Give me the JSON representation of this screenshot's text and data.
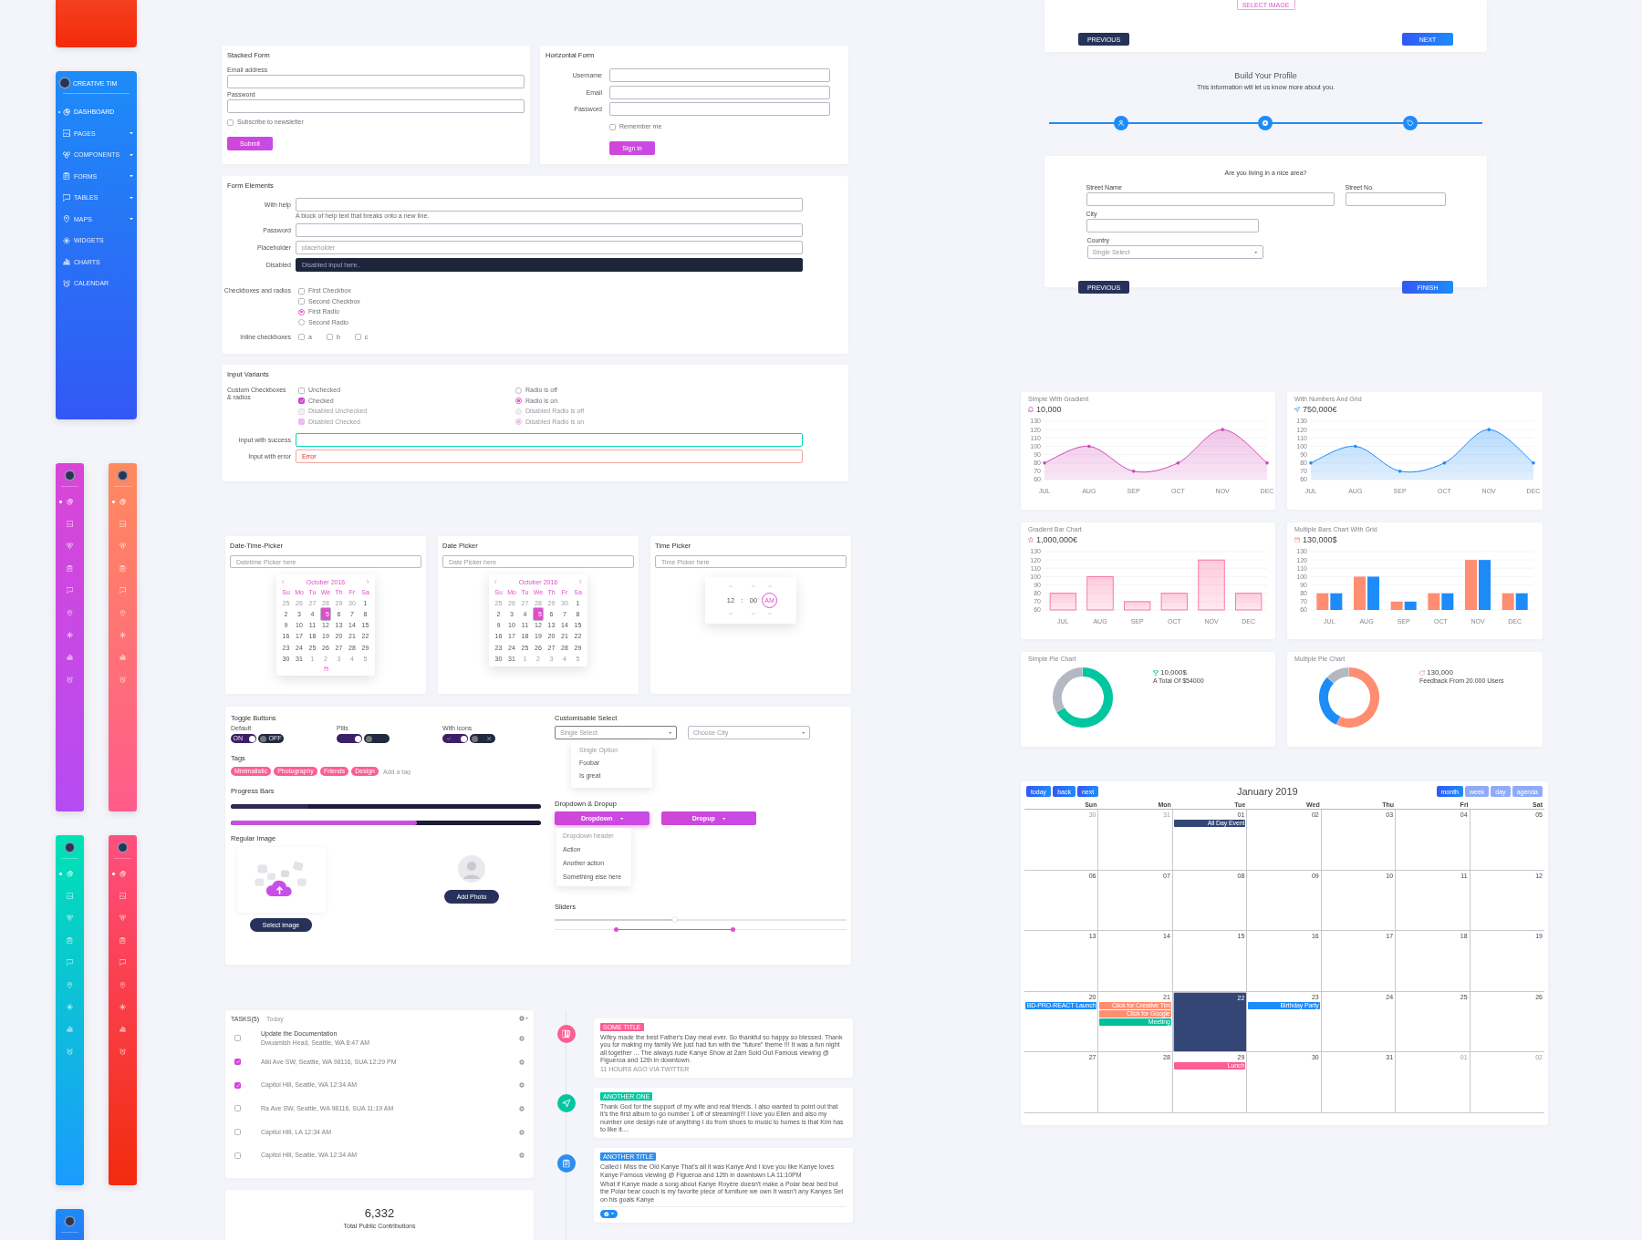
{
  "sidebar": {
    "brand": "CREATIVE TIM",
    "items": [
      {
        "label": "DASHBOARD",
        "selected": true,
        "submenu": false
      },
      {
        "label": "PAGES",
        "selected": false,
        "submenu": true
      },
      {
        "label": "COMPONENTS",
        "selected": false,
        "submenu": true
      },
      {
        "label": "FORMS",
        "selected": false,
        "submenu": true
      },
      {
        "label": "TABLES",
        "selected": false,
        "submenu": true
      },
      {
        "label": "MAPS",
        "selected": false,
        "submenu": true
      },
      {
        "label": "WIDGETS",
        "selected": false,
        "submenu": false
      },
      {
        "label": "CHARTS",
        "selected": false,
        "submenu": false
      },
      {
        "label": "CALENDAR",
        "selected": false,
        "submenu": false
      }
    ]
  },
  "mini_sidebars": [
    {
      "color": "#d946d6",
      "items": [
        {
          "selected": true
        },
        {
          "selected": false
        },
        {
          "selected": false
        },
        {
          "selected": false
        },
        {
          "selected": false
        },
        {
          "selected": false
        },
        {
          "selected": false
        },
        {
          "selected": false
        },
        {
          "selected": false
        }
      ]
    },
    {
      "color": "#ff8a5e",
      "items": [
        {
          "selected": true
        },
        {
          "selected": false
        },
        {
          "selected": false
        },
        {
          "selected": false
        },
        {
          "selected": false
        },
        {
          "selected": false
        },
        {
          "selected": false
        },
        {
          "selected": false
        },
        {
          "selected": false
        }
      ]
    },
    {
      "color": "#00e2b4",
      "items": [
        {
          "selected": true
        },
        {
          "selected": false
        },
        {
          "selected": false
        },
        {
          "selected": false
        },
        {
          "selected": false
        },
        {
          "selected": false
        },
        {
          "selected": false
        },
        {
          "selected": false
        },
        {
          "selected": false
        }
      ]
    },
    {
      "color": "#ff4f7f",
      "items": [
        {
          "selected": true
        },
        {
          "selected": false
        },
        {
          "selected": false
        },
        {
          "selected": false
        },
        {
          "selected": false
        },
        {
          "selected": false
        },
        {
          "selected": false
        },
        {
          "selected": false
        },
        {
          "selected": false
        }
      ]
    },
    {
      "color": "#1d8cf8"
    }
  ],
  "stacked_form": {
    "title": "Stacked Form",
    "fields": [
      {
        "label": "Email address"
      },
      {
        "label": "Password"
      }
    ],
    "checkbox": {
      "label": "Subscribe to newsletter",
      "checked": false
    },
    "button": "Submit"
  },
  "horizontal_form": {
    "title": "Horizontal Form",
    "fields": [
      {
        "label": "Username"
      },
      {
        "label": "Email"
      },
      {
        "label": "Password"
      }
    ],
    "checkbox": {
      "label": "Remember me",
      "checked": false
    },
    "button": "Sign in"
  },
  "form_elements": {
    "title": "Form Elements",
    "fields": [
      {
        "label": "With help",
        "disabled": false,
        "help": "A block of help text that breaks onto a new line."
      },
      {
        "label": "Password",
        "disabled": false
      },
      {
        "label": "Placeholder",
        "disabled": false,
        "placeholder": "placeholder"
      },
      {
        "label": "Disabled",
        "disabled": true,
        "placeholder": "Disabled input here.."
      }
    ],
    "choices": {
      "label": "Checkboxes and radios",
      "items": [
        {
          "kind": "checkbox",
          "label": "First Checkbox",
          "checked": false
        },
        {
          "kind": "checkbox",
          "label": "Second Checkbox",
          "checked": false
        },
        {
          "kind": "radio",
          "label": "First Radio",
          "selected": true
        },
        {
          "kind": "radio",
          "label": "Second Radio",
          "selected": false
        }
      ]
    },
    "inline": {
      "label": "Inline checkboxes",
      "items": [
        {
          "label": "a",
          "checked": false
        },
        {
          "label": "b",
          "checked": false
        },
        {
          "label": "c",
          "checked": false
        }
      ]
    }
  },
  "input_variants": {
    "title": "Input Variants",
    "group_label": "Custom Checkboxes & radios",
    "checkboxes": [
      {
        "label": "Unchecked",
        "checked": false,
        "disabled": false
      },
      {
        "label": "Checked",
        "checked": true,
        "disabled": false
      },
      {
        "label": "Disabled Unchecked",
        "checked": false,
        "disabled": true
      },
      {
        "label": "Disabled Checked",
        "checked": true,
        "disabled": true
      }
    ],
    "radios": [
      {
        "label": "Radio is off",
        "selected": false,
        "disabled": false
      },
      {
        "label": "Radio is on",
        "selected": true,
        "disabled": false
      },
      {
        "label": "Disabled Radio is off",
        "selected": false,
        "disabled": true
      },
      {
        "label": "Disabled Radio is on",
        "selected": true,
        "disabled": true
      }
    ],
    "fields": [
      {
        "label": "Input with success",
        "kind": "success"
      },
      {
        "label": "Input with error",
        "kind": "error",
        "value": "Error"
      }
    ]
  },
  "pickers": [
    {
      "kind": "datetime",
      "title": "Date-Time-Picker",
      "placeholder": "Datetime Picker here",
      "calendar": {
        "month": "October 2016",
        "weekdays": [
          "Su",
          "Mo",
          "Tu",
          "We",
          "Th",
          "Fr",
          "Sa"
        ],
        "days": [
          {
            "day": "25",
            "outside": true,
            "selected": false
          },
          {
            "day": "26",
            "outside": true,
            "selected": false
          },
          {
            "day": "27",
            "outside": true,
            "selected": false
          },
          {
            "day": "28",
            "outside": true,
            "selected": false
          },
          {
            "day": "29",
            "outside": true,
            "selected": false
          },
          {
            "day": "30",
            "outside": true,
            "selected": false
          },
          {
            "day": "1",
            "outside": false,
            "selected": false
          },
          {
            "day": "2",
            "outside": false,
            "selected": false
          },
          {
            "day": "3",
            "outside": false,
            "selected": false
          },
          {
            "day": "4",
            "outside": false,
            "selected": false
          },
          {
            "day": "5",
            "outside": false,
            "selected": true
          },
          {
            "day": "6",
            "outside": false,
            "selected": false
          },
          {
            "day": "7",
            "outside": false,
            "selected": false
          },
          {
            "day": "8",
            "outside": false,
            "selected": false
          },
          {
            "day": "9",
            "outside": false,
            "selected": false
          },
          {
            "day": "10",
            "outside": false,
            "selected": false
          },
          {
            "day": "11",
            "outside": false,
            "selected": false
          },
          {
            "day": "12",
            "outside": false,
            "selected": false
          },
          {
            "day": "13",
            "outside": false,
            "selected": false
          },
          {
            "day": "14",
            "outside": false,
            "selected": false
          },
          {
            "day": "15",
            "outside": false,
            "selected": false
          },
          {
            "day": "16",
            "outside": false,
            "selected": false
          },
          {
            "day": "17",
            "outside": false,
            "selected": false
          },
          {
            "day": "18",
            "outside": false,
            "selected": false
          },
          {
            "day": "19",
            "outside": false,
            "selected": false
          },
          {
            "day": "20",
            "outside": false,
            "selected": false
          },
          {
            "day": "21",
            "outside": false,
            "selected": false
          },
          {
            "day": "22",
            "outside": false,
            "selected": false
          },
          {
            "day": "23",
            "outside": false,
            "selected": false
          },
          {
            "day": "24",
            "outside": false,
            "selected": false
          },
          {
            "day": "25",
            "outside": false,
            "selected": false
          },
          {
            "day": "26",
            "outside": false,
            "selected": false
          },
          {
            "day": "27",
            "outside": false,
            "selected": false
          },
          {
            "day": "28",
            "outside": false,
            "selected": false
          },
          {
            "day": "29",
            "outside": false,
            "selected": false
          },
          {
            "day": "30",
            "outside": false,
            "selected": false
          },
          {
            "day": "31",
            "outside": false,
            "selected": false
          },
          {
            "day": "1",
            "outside": true,
            "selected": false
          },
          {
            "day": "2",
            "outside": true,
            "selected": false
          },
          {
            "day": "3",
            "outside": true,
            "selected": false
          },
          {
            "day": "4",
            "outside": true,
            "selected": false
          },
          {
            "day": "5",
            "outside": true,
            "selected": false
          }
        ]
      }
    },
    {
      "kind": "date",
      "title": "Date Picker",
      "placeholder": "Date Picker here",
      "calendar": {
        "month": "October 2016",
        "weekdays": [
          "Su",
          "Mo",
          "Tu",
          "We",
          "Th",
          "Fr",
          "Sa"
        ],
        "days": [
          {
            "day": "25",
            "outside": true,
            "selected": false
          },
          {
            "day": "26",
            "outside": true,
            "selected": false
          },
          {
            "day": "27",
            "outside": true,
            "selected": false
          },
          {
            "day": "28",
            "outside": true,
            "selected": false
          },
          {
            "day": "29",
            "outside": true,
            "selected": false
          },
          {
            "day": "30",
            "outside": true,
            "selected": false
          },
          {
            "day": "1",
            "outside": false,
            "selected": false
          },
          {
            "day": "2",
            "outside": false,
            "selected": false
          },
          {
            "day": "3",
            "outside": false,
            "selected": false
          },
          {
            "day": "4",
            "outside": false,
            "selected": false
          },
          {
            "day": "5",
            "outside": false,
            "selected": true
          },
          {
            "day": "6",
            "outside": false,
            "selected": false
          },
          {
            "day": "7",
            "outside": false,
            "selected": false
          },
          {
            "day": "8",
            "outside": false,
            "selected": false
          },
          {
            "day": "9",
            "outside": false,
            "selected": false
          },
          {
            "day": "10",
            "outside": false,
            "selected": false
          },
          {
            "day": "11",
            "outside": false,
            "selected": false
          },
          {
            "day": "12",
            "outside": false,
            "selected": false
          },
          {
            "day": "13",
            "outside": false,
            "selected": false
          },
          {
            "day": "14",
            "outside": false,
            "selected": false
          },
          {
            "day": "15",
            "outside": false,
            "selected": false
          },
          {
            "day": "16",
            "outside": false,
            "selected": false
          },
          {
            "day": "17",
            "outside": false,
            "selected": false
          },
          {
            "day": "18",
            "outside": false,
            "selected": false
          },
          {
            "day": "19",
            "outside": false,
            "selected": false
          },
          {
            "day": "20",
            "outside": false,
            "selected": false
          },
          {
            "day": "21",
            "outside": false,
            "selected": false
          },
          {
            "day": "22",
            "outside": false,
            "selected": false
          },
          {
            "day": "23",
            "outside": false,
            "selected": false
          },
          {
            "day": "24",
            "outside": false,
            "selected": false
          },
          {
            "day": "25",
            "outside": false,
            "selected": false
          },
          {
            "day": "26",
            "outside": false,
            "selected": false
          },
          {
            "day": "27",
            "outside": false,
            "selected": false
          },
          {
            "day": "28",
            "outside": false,
            "selected": false
          },
          {
            "day": "29",
            "outside": false,
            "selected": false
          },
          {
            "day": "30",
            "outside": false,
            "selected": false
          },
          {
            "day": "31",
            "outside": false,
            "selected": false
          },
          {
            "day": "1",
            "outside": true,
            "selected": false
          },
          {
            "day": "2",
            "outside": true,
            "selected": false
          },
          {
            "day": "3",
            "outside": true,
            "selected": false
          },
          {
            "day": "4",
            "outside": true,
            "selected": false
          },
          {
            "day": "5",
            "outside": true,
            "selected": false
          }
        ]
      }
    },
    {
      "kind": "time",
      "title": "Time Picker",
      "placeholder": "Time Picker here",
      "time": {
        "hour": "12",
        "separator": ":",
        "minute": "00",
        "period": "AM"
      }
    }
  ],
  "controls": {
    "toggles": {
      "title": "Toggle Buttons",
      "groups": [
        {
          "kind": "text",
          "label": "Default",
          "switches": [
            {
              "on": true,
              "text": "ON"
            },
            {
              "on": false,
              "text": "OFF"
            }
          ]
        },
        {
          "kind": "pill",
          "label": "Pills",
          "switches": [
            {
              "on": true
            },
            {
              "on": false
            }
          ]
        },
        {
          "kind": "icon",
          "label": "With icons",
          "switches": [
            {
              "on": true
            },
            {
              "on": false
            }
          ]
        }
      ]
    },
    "tags": {
      "title": "Tags",
      "items": [
        "Minimalistic",
        "Photography",
        "Friends",
        "Design"
      ],
      "placeholder": "Add a tag"
    },
    "progress": {
      "title": "Progress Bars",
      "bars": [
        {
          "level": 0.25,
          "color": "#2c2a52"
        },
        {
          "level": 0.6,
          "color": "#c94fe0"
        }
      ]
    },
    "image": {
      "title": "Regular Image",
      "select_button": "Select image",
      "add_button": "Add Photo"
    },
    "select": {
      "title": "Customisable Select",
      "items": [
        {
          "placeholder": "Single Select",
          "expanded": true,
          "options": [
            {
              "kind": "header",
              "label": "Single Option"
            },
            {
              "kind": "option",
              "label": "Foobar"
            },
            {
              "kind": "option",
              "label": "Is great"
            }
          ]
        },
        {
          "placeholder": "Choose City",
          "expanded": false
        }
      ]
    },
    "dropdown": {
      "title": "Dropdown & Dropup",
      "buttons": [
        {
          "label": "Dropdown",
          "expanded": true,
          "menu": [
            {
              "kind": "header",
              "label": "Dropdown header"
            },
            {
              "kind": "item",
              "label": "Action"
            },
            {
              "kind": "item",
              "label": "Another action"
            },
            {
              "kind": "item",
              "label": "Something else here"
            }
          ]
        },
        {
          "label": "Dropup",
          "expanded": false
        }
      ]
    },
    "sliders": {
      "title": "Sliders",
      "items": [
        {
          "kind": "single",
          "level": 0.41
        },
        {
          "kind": "range",
          "handles": [
            {
              "level": 0.21
            },
            {
              "level": 0.61
            }
          ]
        }
      ]
    }
  },
  "tasks": {
    "tabs": [
      {
        "label": "TASKS(5)",
        "selected": true
      },
      {
        "label": "Today",
        "selected": false
      }
    ],
    "rows": [
      {
        "title": "Update the Documentation",
        "subtitle": "Dwuamish Head, Seattle, WA 8:47 AM",
        "checked": false
      },
      {
        "subtitle": "Alki Ave SW, Seattle, WA 98116, SUA 12:29 PM",
        "checked": true
      },
      {
        "subtitle": "Capitol Hill, Seattle, WA 12:34 AM",
        "checked": true
      },
      {
        "subtitle": "Ra Ave SW, Seattle, WA 98116, SUA 11:19 AM",
        "checked": false
      },
      {
        "subtitle": "Capitol Hill, LA 12:34 AM",
        "checked": false
      },
      {
        "subtitle": "Capitol Hill, Seattle, WA 12:34 AM",
        "checked": false
      }
    ]
  },
  "contributions": {
    "value": "6,332",
    "label": "Total Public Contributions"
  },
  "timeline": [
    {
      "badge": "SOME TITLE",
      "color": "#fd5d93",
      "paragraphs": [
        "Wifey made the best Father's Day meal ever. So thankful so happy so blessed. Thank you for making my family We just had fun with the “future” theme !!! It was a fun night all together ... The always rude Kanye Show at 2am Sold Out Famous viewing @ Figueroa and 12th in downtown."
      ],
      "footer": "11 HOURS AGO VIA TWITTER",
      "menu_button": false
    },
    {
      "badge": "ANOTHER ONE",
      "color": "#00c7a0",
      "paragraphs": [
        "Thank God for the support of my wife and real friends. I also wanted to point out that it’s the first album to go number 1 off of streaming!!! I love you Ellen and also my number one design rule of anything I do from shoes to music to homes is that Kim has to like it...."
      ],
      "menu_button": false
    },
    {
      "badge": "ANOTHER TITLE",
      "color": "#2d8ef0",
      "paragraphs": [
        "Called I Miss the Old Kanye That’s all it was Kanye And I love you like Kanye loves Kanye Famous viewing @ Figueroa and 12th in downtown LA 11:10PM",
        "What if Kanye made a song about Kanye Royère doesn't make a Polar bear bed but the Polar bear couch is my favorite piece of furniture we own It wasn’t any Kanyes Set on his goals Kanye"
      ],
      "menu_button": true
    }
  ],
  "wizard": {
    "image_button": "SELECT IMAGE",
    "previous": "PREVIOUS",
    "next": "NEXT",
    "heading": "Build Your Profile",
    "subheading": "This information will let us know more about you.",
    "address": {
      "question": "Are you living in a nice area?",
      "fields": [
        {
          "label": "Street Name",
          "kind": "text"
        },
        {
          "label": "Street No.",
          "kind": "text"
        },
        {
          "label": "City",
          "kind": "text"
        },
        {
          "label": "Country",
          "kind": "select",
          "placeholder": "Single Select"
        }
      ],
      "previous": "PREVIOUS",
      "finish": "FINISH"
    }
  },
  "charts": [
    {
      "kind": "line",
      "title": "Simple With Gradient",
      "value": "10,000",
      "chart_data": {
        "type": "area",
        "categories": [
          "JUL",
          "AUG",
          "SEP",
          "OCT",
          "NOV",
          "DEC"
        ],
        "series": [
          {
            "color": "#d048b6",
            "values": [
              80,
              100,
              70,
              80,
              120,
              80
            ]
          }
        ],
        "ylim": [
          60,
          130
        ],
        "yticks": [
          60,
          70,
          80,
          90,
          100,
          110,
          120,
          130
        ],
        "grid": true
      }
    },
    {
      "kind": "line",
      "title": "With Numbers And Grid",
      "value": "750,000€",
      "chart_data": {
        "type": "area",
        "categories": [
          "JUL",
          "AUG",
          "SEP",
          "OCT",
          "NOV",
          "DEC"
        ],
        "series": [
          {
            "color": "#1d8cf8",
            "values": [
              80,
              100,
              70,
              80,
              120,
              80
            ]
          }
        ],
        "ylim": [
          60,
          130
        ],
        "yticks": [
          60,
          70,
          80,
          90,
          100,
          110,
          120,
          130
        ],
        "grid": true
      }
    },
    {
      "kind": "bar",
      "title": "Gradient Bar Chart",
      "value": "1,000,000€",
      "chart_data": {
        "type": "bar",
        "categories": [
          "JUL",
          "AUG",
          "SEP",
          "OCT",
          "NOV",
          "DEC"
        ],
        "series": [
          {
            "color": "#fd5d93",
            "values": [
              80,
              100,
              70,
              80,
              120,
              80
            ]
          }
        ],
        "ylim": [
          60,
          130
        ],
        "yticks": [
          60,
          70,
          80,
          90,
          100,
          110,
          120,
          130
        ],
        "grid": true
      }
    },
    {
      "kind": "bar",
      "title": "Multiple Bars Chart With Grid",
      "value": "130,000$",
      "chart_data": {
        "type": "bar",
        "categories": [
          "JUL",
          "AUG",
          "SEP",
          "OCT",
          "NOV",
          "DEC"
        ],
        "series": [
          {
            "color": "#ff8d72",
            "values": [
              80,
              100,
              70,
              80,
              120,
              80
            ]
          },
          {
            "color": "#1d8cf8",
            "values": [
              80,
              100,
              70,
              80,
              120,
              80
            ]
          }
        ],
        "ylim": [
          60,
          130
        ],
        "yticks": [
          60,
          70,
          80,
          90,
          100,
          110,
          120,
          130
        ],
        "grid": true
      }
    },
    {
      "kind": "donut",
      "title": "Simple Pie Chart",
      "value": "10,000$",
      "caption": "A Total Of $54000",
      "slices": [
        {
          "color": "#00c7a0"
        },
        {
          "color": "#b3b8c2"
        }
      ]
    },
    {
      "kind": "donut",
      "title": "Multiple Pie Chart",
      "value": "130,000",
      "caption": "Feedback From 20.000 Users",
      "slices": [
        {
          "color": "#ff8d72"
        },
        {
          "color": "#1d8cf8"
        },
        {
          "color": "#b3b8c2"
        }
      ]
    }
  ],
  "calendar": {
    "title": "January 2019",
    "nav": [
      "today",
      "back",
      "next"
    ],
    "views": [
      {
        "label": "month",
        "selected": true
      },
      {
        "label": "week",
        "selected": false
      },
      {
        "label": "day",
        "selected": false
      },
      {
        "label": "agenda",
        "selected": false
      }
    ],
    "weekdays": [
      "Sun",
      "Mon",
      "Tue",
      "Wed",
      "Thu",
      "Fri",
      "Sat"
    ],
    "days": [
      {
        "day": "30",
        "outside": true,
        "selected": false
      },
      {
        "day": "31",
        "outside": true,
        "selected": false
      },
      {
        "day": "01",
        "outside": false,
        "selected": false,
        "events": [
          {
            "title": "All Day Event",
            "color": "#344675"
          }
        ]
      },
      {
        "day": "02",
        "outside": false,
        "selected": false
      },
      {
        "day": "03",
        "outside": false,
        "selected": false
      },
      {
        "day": "04",
        "outside": false,
        "selected": false
      },
      {
        "day": "05",
        "outside": false,
        "selected": false
      },
      {
        "day": "06",
        "outside": false,
        "selected": false
      },
      {
        "day": "07",
        "outside": false,
        "selected": false
      },
      {
        "day": "08",
        "outside": false,
        "selected": false
      },
      {
        "day": "09",
        "outside": false,
        "selected": false
      },
      {
        "day": "10",
        "outside": false,
        "selected": false
      },
      {
        "day": "11",
        "outside": false,
        "selected": false
      },
      {
        "day": "12",
        "outside": false,
        "selected": false
      },
      {
        "day": "13",
        "outside": false,
        "selected": false
      },
      {
        "day": "14",
        "outside": false,
        "selected": false
      },
      {
        "day": "15",
        "outside": false,
        "selected": false
      },
      {
        "day": "16",
        "outside": false,
        "selected": false
      },
      {
        "day": "17",
        "outside": false,
        "selected": false
      },
      {
        "day": "18",
        "outside": false,
        "selected": false
      },
      {
        "day": "19",
        "outside": false,
        "selected": false
      },
      {
        "day": "20",
        "outside": false,
        "selected": false,
        "events": [
          {
            "title": "BD-PRO-REACT Launch",
            "color": "#1d8cf8"
          }
        ]
      },
      {
        "day": "21",
        "outside": false,
        "selected": false,
        "events": [
          {
            "title": "Click for Creative Tim",
            "color": "#ff8d72"
          },
          {
            "title": "Click for Google",
            "color": "#ff8d72"
          },
          {
            "title": "Meeting",
            "color": "#00bf9a"
          }
        ]
      },
      {
        "day": "22",
        "outside": false,
        "selected": true
      },
      {
        "day": "23",
        "outside": false,
        "selected": false,
        "events": [
          {
            "title": "Birthday Party",
            "color": "#1d8cf8"
          }
        ]
      },
      {
        "day": "24",
        "outside": false,
        "selected": false
      },
      {
        "day": "25",
        "outside": false,
        "selected": false
      },
      {
        "day": "26",
        "outside": false,
        "selected": false
      },
      {
        "day": "27",
        "outside": false,
        "selected": false
      },
      {
        "day": "28",
        "outside": false,
        "selected": false
      },
      {
        "day": "29",
        "outside": false,
        "selected": false,
        "events": [
          {
            "title": "Lunch",
            "color": "#fd5d93"
          }
        ]
      },
      {
        "day": "30",
        "outside": false,
        "selected": false
      },
      {
        "day": "31",
        "outside": false,
        "selected": false
      },
      {
        "day": "01",
        "outside": true,
        "selected": false
      },
      {
        "day": "02",
        "outside": true,
        "selected": false
      }
    ]
  }
}
